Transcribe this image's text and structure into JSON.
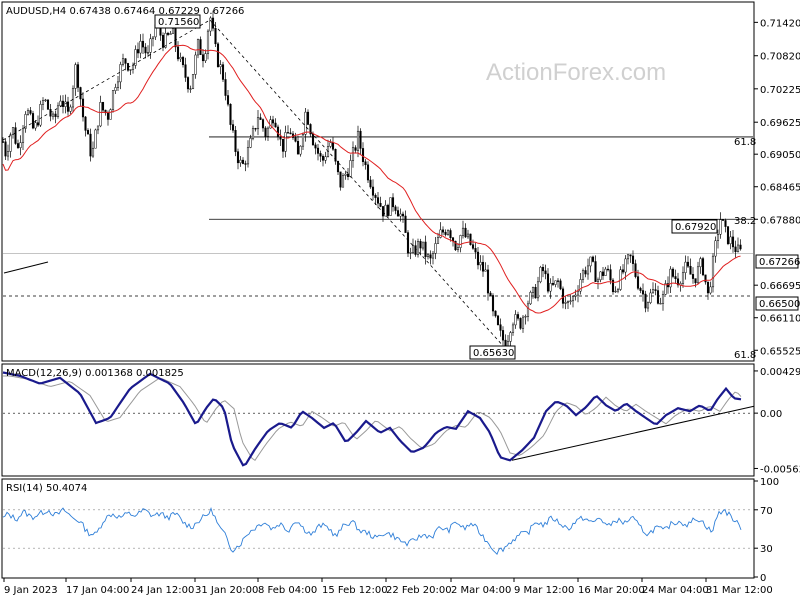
{
  "chart_data": [
    {
      "type": "candlestick",
      "title": "AUDUSD,H4  0.67438 0.67464 0.67229 0.67266",
      "watermark": "ActionForex.com",
      "ylim": [
        0.6535,
        0.7175
      ],
      "y_ticks": [
        "0.71420",
        "0.70820",
        "0.70225",
        "0.69625",
        "0.69050",
        "0.68465",
        "0.67880",
        "0.66695",
        "0.66110",
        "0.65525"
      ],
      "x_ticks": [
        "9 Jan 2023",
        "17 Jan 04:00",
        "24 Jan 12:00",
        "31 Jan 20:00",
        "8 Feb 04:00",
        "15 Feb 12:00",
        "22 Feb 20:00",
        "2 Mar 04:00",
        "9 Mar 12:00",
        "16 Mar 20:00",
        "24 Mar 04:00",
        "31 Mar 12:00"
      ],
      "current_price": "0.67266",
      "support_level": "0.66500",
      "annotations": {
        "high": "0.71560",
        "low": "0.65630",
        "swing_high": "0.67920",
        "fib_upper": "61.8",
        "fib_mid": "38.2",
        "fib_lower": "61.8"
      },
      "levels": {
        "fib_upper": 0.6936,
        "fib_mid": 0.6788,
        "fib_lower": 0.6548,
        "current": 0.67266,
        "support": 0.665
      },
      "price_path": [
        [
          0,
          0.695
        ],
        [
          6,
          0.6905
        ],
        [
          12,
          0.6955
        ],
        [
          18,
          0.6915
        ],
        [
          26,
          0.699
        ],
        [
          34,
          0.6945
        ],
        [
          44,
          0.7005
        ],
        [
          54,
          0.696
        ],
        [
          60,
          0.701
        ],
        [
          68,
          0.6975
        ],
        [
          76,
          0.7065
        ],
        [
          84,
          0.696
        ],
        [
          92,
          0.69
        ],
        [
          100,
          0.699
        ],
        [
          108,
          0.6975
        ],
        [
          116,
          0.704
        ],
        [
          124,
          0.7075
        ],
        [
          132,
          0.706
        ],
        [
          140,
          0.711
        ],
        [
          148,
          0.708
        ],
        [
          156,
          0.714
        ],
        [
          164,
          0.7105
        ],
        [
          172,
          0.7125
        ],
        [
          180,
          0.707
        ],
        [
          190,
          0.7025
        ],
        [
          198,
          0.71
        ],
        [
          204,
          0.708
        ],
        [
          210,
          0.7156
        ],
        [
          216,
          0.7085
        ],
        [
          224,
          0.704
        ],
        [
          230,
          0.696
        ],
        [
          236,
          0.691
        ],
        [
          242,
          0.688
        ],
        [
          250,
          0.692
        ],
        [
          258,
          0.6975
        ],
        [
          266,
          0.694
        ],
        [
          274,
          0.698
        ],
        [
          282,
          0.6915
        ],
        [
          290,
          0.695
        ],
        [
          298,
          0.69
        ],
        [
          306,
          0.6985
        ],
        [
          314,
          0.6925
        ],
        [
          322,
          0.689
        ],
        [
          330,
          0.693
        ],
        [
          340,
          0.685
        ],
        [
          350,
          0.6885
        ],
        [
          358,
          0.6935
        ],
        [
          366,
          0.688
        ],
        [
          374,
          0.684
        ],
        [
          384,
          0.68
        ],
        [
          394,
          0.682
        ],
        [
          402,
          0.679
        ],
        [
          410,
          0.672
        ],
        [
          420,
          0.6745
        ],
        [
          430,
          0.671
        ],
        [
          440,
          0.676
        ],
        [
          448,
          0.6775
        ],
        [
          456,
          0.674
        ],
        [
          462,
          0.6765
        ],
        [
          470,
          0.6745
        ],
        [
          478,
          0.671
        ],
        [
          486,
          0.669
        ],
        [
          492,
          0.662
        ],
        [
          500,
          0.658
        ],
        [
          506,
          0.6563
        ],
        [
          512,
          0.661
        ],
        [
          520,
          0.66
        ],
        [
          528,
          0.664
        ],
        [
          536,
          0.666
        ],
        [
          542,
          0.67
        ],
        [
          550,
          0.666
        ],
        [
          558,
          0.6675
        ],
        [
          566,
          0.663
        ],
        [
          574,
          0.665
        ],
        [
          582,
          0.669
        ],
        [
          590,
          0.671
        ],
        [
          598,
          0.668
        ],
        [
          606,
          0.67
        ],
        [
          614,
          0.666
        ],
        [
          622,
          0.669
        ],
        [
          630,
          0.672
        ],
        [
          638,
          0.6675
        ],
        [
          646,
          0.664
        ],
        [
          654,
          0.666
        ],
        [
          662,
          0.664
        ],
        [
          670,
          0.669
        ],
        [
          678,
          0.668
        ],
        [
          686,
          0.67
        ],
        [
          694,
          0.668
        ],
        [
          702,
          0.671
        ],
        [
          708,
          0.665
        ],
        [
          714,
          0.672
        ],
        [
          720,
          0.6792
        ],
        [
          726,
          0.676
        ],
        [
          732,
          0.6745
        ],
        [
          738,
          0.673
        ],
        [
          742,
          0.67266
        ]
      ]
    },
    {
      "type": "line",
      "title": "MACD(12,26,9) 0.001368 0.001825",
      "y_ticks": [
        "0.004299",
        "0.00",
        "-0.005636"
      ],
      "ylim": [
        -0.0062,
        0.0047
      ],
      "macd": [
        [
          0,
          0.0042
        ],
        [
          20,
          0.0038
        ],
        [
          40,
          0.003
        ],
        [
          60,
          0.0036
        ],
        [
          80,
          0.002
        ],
        [
          96,
          -0.001
        ],
        [
          110,
          -0.0005
        ],
        [
          130,
          0.0025
        ],
        [
          150,
          0.004
        ],
        [
          170,
          0.003
        ],
        [
          184,
          0.001
        ],
        [
          196,
          -0.0012
        ],
        [
          206,
          0.0005
        ],
        [
          214,
          0.0015
        ],
        [
          224,
          0.0005
        ],
        [
          232,
          -0.0032
        ],
        [
          244,
          -0.0055
        ],
        [
          256,
          -0.0035
        ],
        [
          268,
          -0.0018
        ],
        [
          280,
          -0.001
        ],
        [
          292,
          -0.0015
        ],
        [
          302,
          0.0002
        ],
        [
          312,
          -0.0005
        ],
        [
          324,
          -0.0015
        ],
        [
          334,
          -0.001
        ],
        [
          346,
          -0.003
        ],
        [
          356,
          -0.002
        ],
        [
          366,
          -0.0008
        ],
        [
          380,
          -0.002
        ],
        [
          390,
          -0.0015
        ],
        [
          400,
          -0.0028
        ],
        [
          412,
          -0.004
        ],
        [
          424,
          -0.0035
        ],
        [
          436,
          -0.002
        ],
        [
          446,
          -0.0014
        ],
        [
          456,
          -0.0016
        ],
        [
          468,
          0.0002
        ],
        [
          480,
          -0.0005
        ],
        [
          490,
          -0.002
        ],
        [
          500,
          -0.0045
        ],
        [
          510,
          -0.0048
        ],
        [
          522,
          -0.0038
        ],
        [
          534,
          -0.0025
        ],
        [
          546,
          0.0002
        ],
        [
          556,
          0.0012
        ],
        [
          566,
          0.0008
        ],
        [
          576,
          -0.0002
        ],
        [
          586,
          0.0006
        ],
        [
          596,
          0.0018
        ],
        [
          606,
          0.0008
        ],
        [
          616,
          0.0002
        ],
        [
          626,
          0.001
        ],
        [
          636,
          0.0002
        ],
        [
          646,
          -0.0005
        ],
        [
          656,
          -0.0012
        ],
        [
          666,
          -0.0002
        ],
        [
          678,
          0.0005
        ],
        [
          690,
          0.0002
        ],
        [
          700,
          0.0008
        ],
        [
          710,
          0.0002
        ],
        [
          718,
          0.0015
        ],
        [
          726,
          0.0025
        ],
        [
          734,
          0.0015
        ],
        [
          742,
          0.0014
        ]
      ],
      "trendline": [
        [
          512,
          -0.0048
        ],
        [
          754,
          0.0007
        ]
      ],
      "title_color": "#000000"
    },
    {
      "type": "line",
      "title": "RSI(14) 50.4074",
      "ylim": [
        0,
        100
      ],
      "y_ticks": [
        "100",
        "70",
        "30",
        "0"
      ],
      "rsi": [
        [
          0,
          58
        ],
        [
          8,
          66
        ],
        [
          16,
          60
        ],
        [
          24,
          68
        ],
        [
          32,
          62
        ],
        [
          40,
          66
        ],
        [
          48,
          70
        ],
        [
          56,
          64
        ],
        [
          64,
          70
        ],
        [
          72,
          62
        ],
        [
          80,
          58
        ],
        [
          88,
          46
        ],
        [
          96,
          44
        ],
        [
          104,
          60
        ],
        [
          112,
          66
        ],
        [
          120,
          62
        ],
        [
          128,
          66
        ],
        [
          136,
          64
        ],
        [
          144,
          70
        ],
        [
          152,
          64
        ],
        [
          160,
          66
        ],
        [
          168,
          62
        ],
        [
          176,
          66
        ],
        [
          184,
          56
        ],
        [
          192,
          52
        ],
        [
          200,
          60
        ],
        [
          206,
          64
        ],
        [
          212,
          70
        ],
        [
          218,
          54
        ],
        [
          226,
          42
        ],
        [
          232,
          28
        ],
        [
          240,
          34
        ],
        [
          248,
          46
        ],
        [
          256,
          52
        ],
        [
          264,
          58
        ],
        [
          272,
          50
        ],
        [
          280,
          56
        ],
        [
          288,
          48
        ],
        [
          296,
          60
        ],
        [
          304,
          50
        ],
        [
          312,
          44
        ],
        [
          320,
          54
        ],
        [
          328,
          52
        ],
        [
          336,
          42
        ],
        [
          344,
          54
        ],
        [
          352,
          58
        ],
        [
          360,
          48
        ],
        [
          368,
          46
        ],
        [
          376,
          40
        ],
        [
          384,
          46
        ],
        [
          392,
          44
        ],
        [
          400,
          38
        ],
        [
          408,
          34
        ],
        [
          416,
          40
        ],
        [
          424,
          44
        ],
        [
          432,
          42
        ],
        [
          440,
          52
        ],
        [
          448,
          48
        ],
        [
          456,
          58
        ],
        [
          464,
          50
        ],
        [
          472,
          56
        ],
        [
          480,
          46
        ],
        [
          488,
          36
        ],
        [
          496,
          26
        ],
        [
          504,
          30
        ],
        [
          512,
          38
        ],
        [
          520,
          44
        ],
        [
          528,
          46
        ],
        [
          536,
          58
        ],
        [
          544,
          54
        ],
        [
          552,
          62
        ],
        [
          560,
          56
        ],
        [
          568,
          50
        ],
        [
          576,
          58
        ],
        [
          584,
          62
        ],
        [
          592,
          56
        ],
        [
          600,
          62
        ],
        [
          608,
          52
        ],
        [
          616,
          60
        ],
        [
          624,
          56
        ],
        [
          632,
          62
        ],
        [
          640,
          52
        ],
        [
          648,
          44
        ],
        [
          656,
          52
        ],
        [
          664,
          48
        ],
        [
          672,
          56
        ],
        [
          680,
          58
        ],
        [
          688,
          54
        ],
        [
          696,
          62
        ],
        [
          704,
          56
        ],
        [
          712,
          46
        ],
        [
          718,
          66
        ],
        [
          724,
          70
        ],
        [
          732,
          62
        ],
        [
          742,
          50
        ]
      ]
    }
  ]
}
